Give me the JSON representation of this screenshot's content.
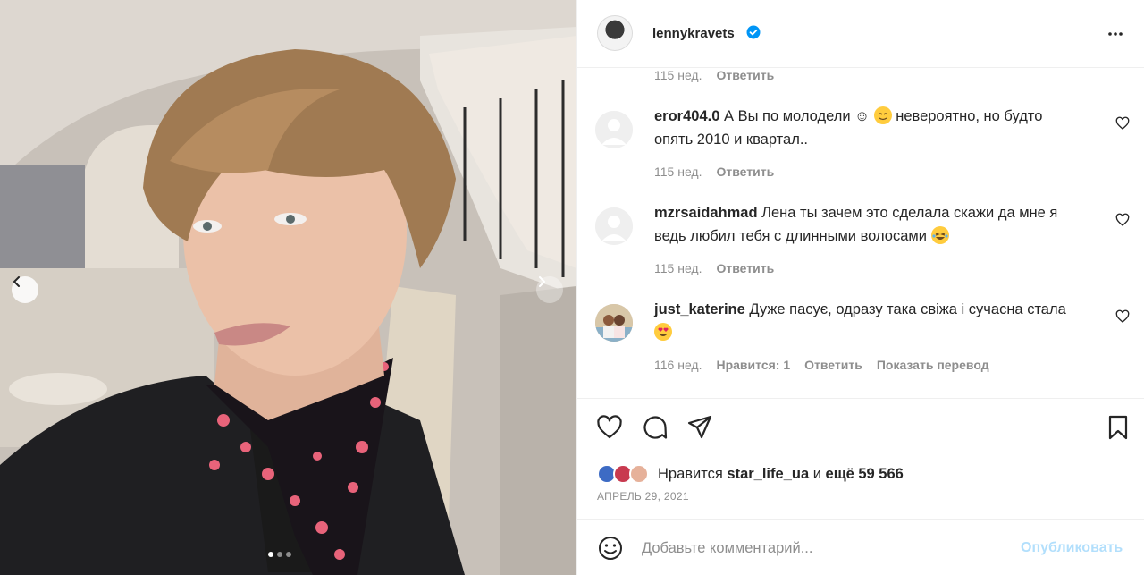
{
  "post": {
    "username": "lennykravets",
    "verified": true,
    "date": "АПРЕЛЬ 29, 2021"
  },
  "comments": {
    "top_time": "115 нед.",
    "top_reply": "Ответить",
    "items": [
      {
        "username": "eror404.0",
        "text_before": " А Вы по молодели ☺",
        "text_after": " невероятно, но будто опять 2010 и квартал..",
        "time": "115 нед.",
        "reply": "Ответить"
      },
      {
        "username": "mzrsaidahmad",
        "text_before": " Лена ты зачем это сделала скажи да мне я ведь любил тебя с длинными волосами ",
        "text_after": "",
        "time": "115 нед.",
        "reply": "Ответить"
      },
      {
        "username": "just_katerine",
        "text_before": " Дуже пасує, одразу така свіжа і сучасна стала ",
        "text_after": "",
        "time": "116 нед.",
        "likes": "Нравится: 1",
        "reply": "Ответить",
        "translate": "Показать перевод"
      }
    ]
  },
  "likes": {
    "prefix": "Нравится ",
    "user": "star_life_ua",
    "middle": " и ",
    "count": "ещё 59 566"
  },
  "add_comment": {
    "placeholder": "Добавьте комментарий...",
    "publish": "Опубликовать"
  },
  "icons": {
    "like": "heart-icon",
    "comment": "comment-icon",
    "share": "paper-plane-icon",
    "save": "bookmark-icon",
    "emoji": "smile-icon",
    "more": "more-icon"
  },
  "colors": {
    "verified": "#0095f6",
    "publish_disabled": "#b2dffc",
    "muted": "#8e8e8e"
  }
}
